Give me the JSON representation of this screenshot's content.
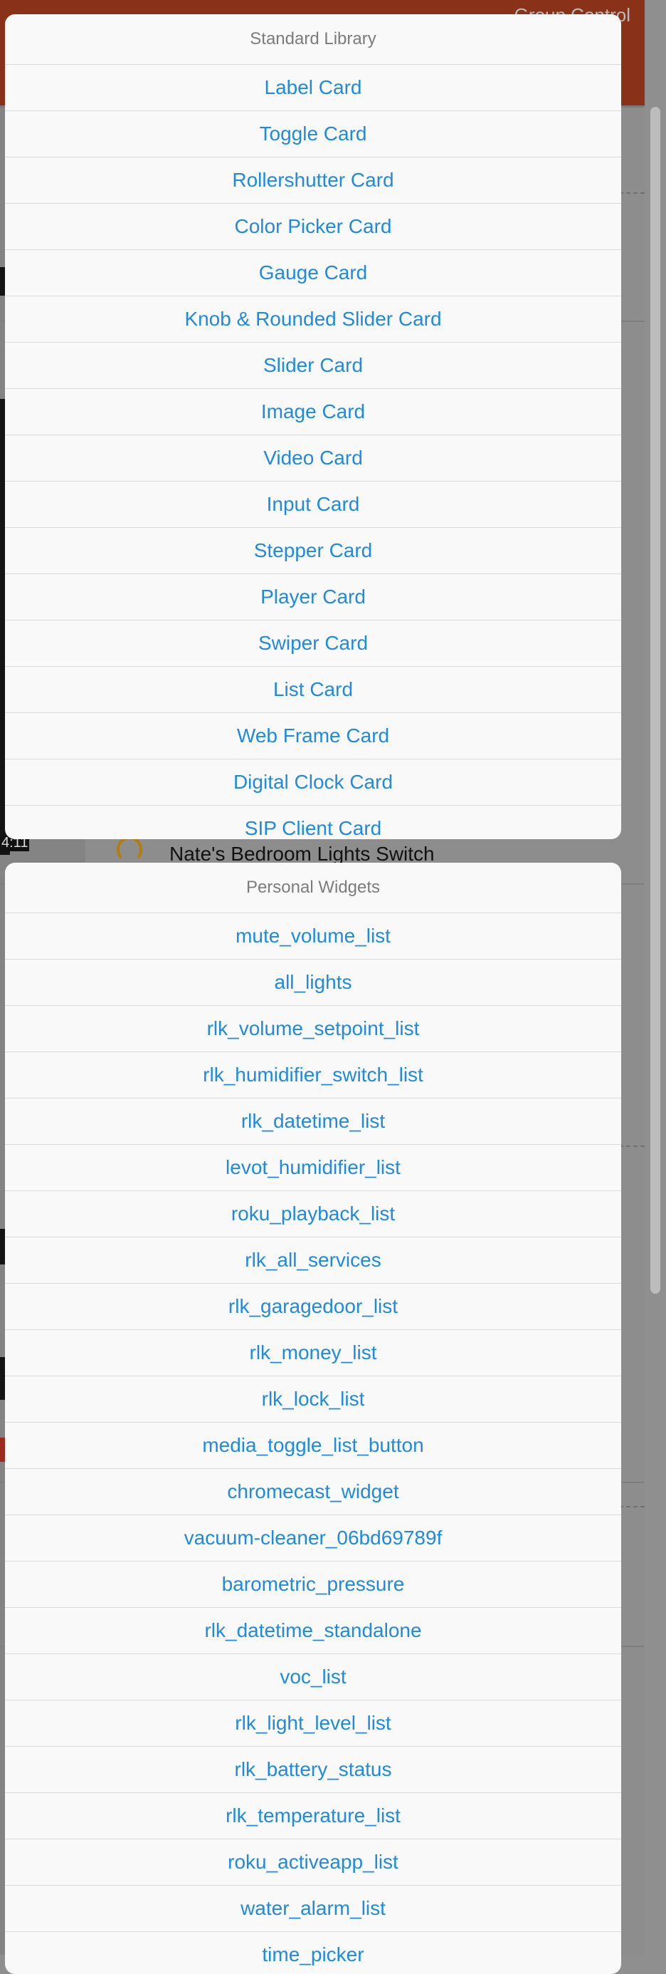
{
  "background": {
    "header_text": "Group Control",
    "row_label": "Nate's Bedroom Lights Switch",
    "media_time": "4:11"
  },
  "standard_library": {
    "title": "Standard Library",
    "items": [
      "Label Card",
      "Toggle Card",
      "Rollershutter Card",
      "Color Picker Card",
      "Gauge Card",
      "Knob & Rounded Slider Card",
      "Slider Card",
      "Image Card",
      "Video Card",
      "Input Card",
      "Stepper Card",
      "Player Card",
      "Swiper Card",
      "List Card",
      "Web Frame Card",
      "Digital Clock Card",
      "SIP Client Card"
    ]
  },
  "personal_widgets": {
    "title": "Personal Widgets",
    "items": [
      "mute_volume_list",
      "all_lights",
      "rlk_volume_setpoint_list",
      "rlk_humidifier_switch_list",
      "rlk_datetime_list",
      "levot_humidifier_list",
      "roku_playback_list",
      "rlk_all_services",
      "rlk_garagedoor_list",
      "rlk_money_list",
      "rlk_lock_list",
      "media_toggle_list_button",
      "chromecast_widget",
      "vacuum-cleaner_06bd69789f",
      "barometric_pressure",
      "rlk_datetime_standalone",
      "voc_list",
      "rlk_light_level_list",
      "rlk_battery_status",
      "rlk_temperature_list",
      "roku_activeapp_list",
      "water_alarm_list",
      "time_picker"
    ]
  }
}
